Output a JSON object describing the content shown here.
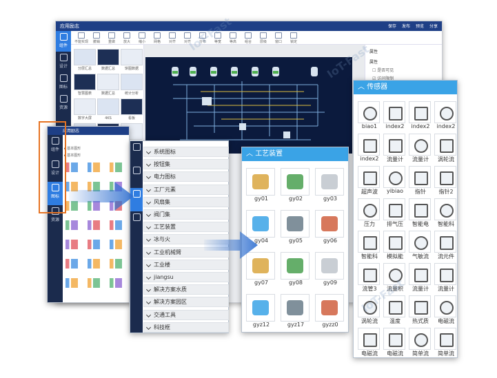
{
  "main_window": {
    "title": "应用励志",
    "actions": [
      "保存",
      "发布",
      "预览",
      "分享"
    ],
    "toolbar": [
      "不能实现",
      "撤销",
      "重做",
      "放大",
      "缩小",
      "网格",
      "对齐",
      "对齐",
      "分布",
      "等宽",
      "等高",
      "组合",
      "层级",
      "窗口",
      "锁定"
    ],
    "nav": [
      "组件",
      "设计",
      "图标",
      "资源"
    ],
    "library_items": [
      "分层汇总",
      "数据汇总",
      "饼图数据",
      "智慧图表",
      "数据汇总",
      "统计分析",
      "数字大屏",
      "4KS",
      "看板",
      "数据表单",
      "数据汇总",
      "智能办公"
    ],
    "props": {
      "tab": "属性",
      "section": "属性",
      "options": [
        "是否可见",
        "访问限制"
      ]
    }
  },
  "second_window": {
    "title": "应用励志",
    "nav": [
      "组件",
      "设计",
      "图标",
      "资源"
    ],
    "items": [
      "基本图形",
      "基本图形"
    ]
  },
  "category_list": {
    "items": [
      "系统图标",
      "按钮集",
      "电力图标",
      "工厂元素",
      "风扇集",
      "阀门集",
      "工艺装置",
      "冰与火",
      "工业机械臂",
      "工业楼",
      "jiangsu",
      "解决方案水质",
      "解决方案园区",
      "交通工具",
      "科技框"
    ]
  },
  "process_panel": {
    "title": "工艺装置",
    "items": [
      "gy01",
      "gy02",
      "gy03",
      "gy04",
      "gy05",
      "gy06",
      "gy07",
      "gy08",
      "gy09",
      "gyz12",
      "gyz17",
      "gyzz0"
    ]
  },
  "sensor_panel": {
    "title": "传感器",
    "items": [
      "biao1",
      "index2",
      "index2",
      "index2",
      "index2",
      "流量计",
      "流量计",
      "涡轮流",
      "超声波",
      "yibiao",
      "指针",
      "指针2",
      "压力",
      "排气压",
      "智能电",
      "智能科",
      "智能科",
      "模拟能",
      "气敏流",
      "流元件",
      "流管3",
      "流量积",
      "流量计",
      "流量计",
      "涡轮流",
      "温度",
      "热式质",
      "电磁流",
      "电磁流",
      "电磁流",
      "简单流",
      "简单流"
    ]
  },
  "watermark": "IoT-Fast",
  "colors": {
    "accent": "#3aa3e6",
    "navbar": "#1e3f86",
    "sidebar": "#1b2b4d",
    "highlight": "#e67322",
    "arrow": "#2f6fd0"
  }
}
